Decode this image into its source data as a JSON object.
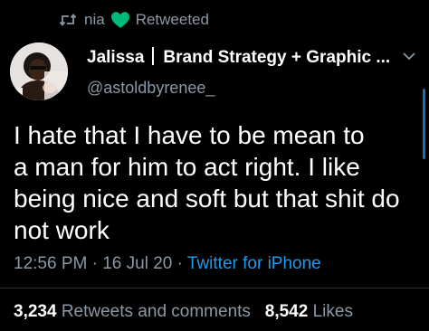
{
  "colors": {
    "background": "#000000",
    "text": "#ffffff",
    "secondary_text": "#8b98a5",
    "link": "#1d9bf0",
    "heart": "#00ba7c",
    "divider": "#2f3336",
    "scrollbar": "#1c6fb0"
  },
  "retweet_context": {
    "icon": "retweet-icon",
    "user": "nia",
    "emoji": "green-heart-icon",
    "label": "Retweeted"
  },
  "author": {
    "avatar": "avatar",
    "display_name": "Jalissa",
    "bio_name": "Brand Strategy + Graphic ...",
    "handle": "@astoldbyrenee_",
    "menu_icon": "chevron-down-icon"
  },
  "tweet": {
    "lines": [
      "I hate that I have to be mean to",
      "a man for him to act right. I like",
      "being nice and soft but that shit do",
      "not work"
    ],
    "time": "12:56 PM",
    "date": "16 Jul 20",
    "separator": "·",
    "source": "Twitter for iPhone"
  },
  "stats": {
    "retweets_count": "3,234",
    "retweets_label": "Retweets and comments",
    "likes_count": "8,542",
    "likes_label": "Likes"
  }
}
